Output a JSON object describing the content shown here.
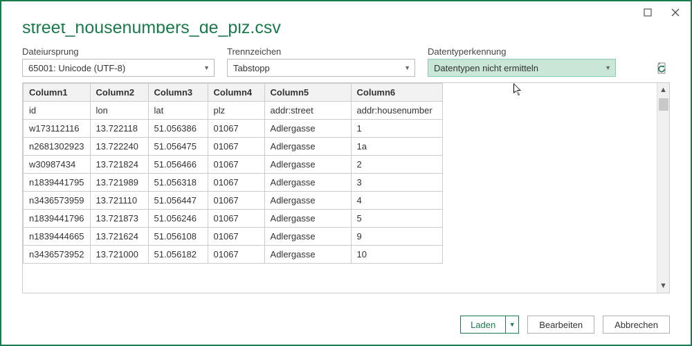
{
  "title": "street_housenumbers_de_plz.csv",
  "controls": {
    "origin": {
      "label": "Dateiursprung",
      "value": "65001: Unicode (UTF-8)"
    },
    "delimiter": {
      "label": "Trennzeichen",
      "value": "Tabstopp"
    },
    "datatype": {
      "label": "Datentyperkennung",
      "value": "Datentypen nicht ermitteln"
    }
  },
  "table": {
    "headers": [
      "Column1",
      "Column2",
      "Column3",
      "Column4",
      "Column5",
      "Column6"
    ],
    "rows": [
      [
        "id",
        "lon",
        "lat",
        "plz",
        "addr:street",
        "addr:housenumber"
      ],
      [
        "w173112116",
        "13.722118",
        "51.056386",
        "01067",
        "Adlergasse",
        "1"
      ],
      [
        "n2681302923",
        "13.722240",
        "51.056475",
        "01067",
        "Adlergasse",
        "1a"
      ],
      [
        "w30987434",
        "13.721824",
        "51.056466",
        "01067",
        "Adlergasse",
        "2"
      ],
      [
        "n1839441795",
        "13.721989",
        "51.056318",
        "01067",
        "Adlergasse",
        "3"
      ],
      [
        "n3436573959",
        "13.721110",
        "51.056447",
        "01067",
        "Adlergasse",
        "4"
      ],
      [
        "n1839441796",
        "13.721873",
        "51.056246",
        "01067",
        "Adlergasse",
        "5"
      ],
      [
        "n1839444665",
        "13.721624",
        "51.056108",
        "01067",
        "Adlergasse",
        "9"
      ],
      [
        "n3436573952",
        "13.721000",
        "51.056182",
        "01067",
        "Adlergasse",
        "10"
      ]
    ]
  },
  "buttons": {
    "load": "Laden",
    "edit": "Bearbeiten",
    "cancel": "Abbrechen"
  }
}
